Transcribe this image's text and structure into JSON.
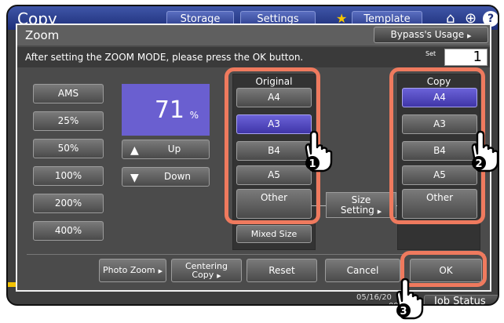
{
  "background": {
    "app_title": "Copy",
    "tabs": [
      "Storage",
      "Settings",
      "Template"
    ],
    "home_icon": "home-icon",
    "globe_icon": "globe-icon",
    "help_icon": "help-icon",
    "help_label": "?",
    "date": "05/16/20",
    "time": "09",
    "job_status": "Job Status"
  },
  "dialog": {
    "title": "Zoom",
    "bypass_button": "Bypass's Usage",
    "instruction": "After setting the ZOOM MODE, please press the OK button.",
    "set_label": "Set",
    "set_value": "1",
    "zoom_value": "71",
    "zoom_unit": "%",
    "presets": [
      "AMS",
      "25%",
      "50%",
      "100%",
      "200%",
      "400%"
    ],
    "up_label": "Up",
    "down_label": "Down",
    "original": {
      "label": "Original",
      "sizes": [
        "A4",
        "A3",
        "B4",
        "A5",
        "Other"
      ],
      "selected": "A3",
      "mixed_size": "Mixed Size"
    },
    "copy": {
      "label": "Copy",
      "sizes": [
        "A4",
        "A3",
        "B4",
        "A5",
        "Other"
      ],
      "selected": "A4"
    },
    "size_setting": [
      "Size",
      "Setting"
    ],
    "footer": {
      "photo_zoom": "Photo Zoom",
      "centering_copy": [
        "Centering",
        "Copy"
      ],
      "reset": "Reset",
      "cancel": "Cancel",
      "ok": "OK"
    }
  },
  "callouts": [
    "1",
    "2",
    "3"
  ],
  "colors": {
    "accent": "#ef7a5e",
    "selected": "#4f45c0",
    "title_bar": "#1d2e78",
    "dialog_bg": "#4b4b4b"
  }
}
